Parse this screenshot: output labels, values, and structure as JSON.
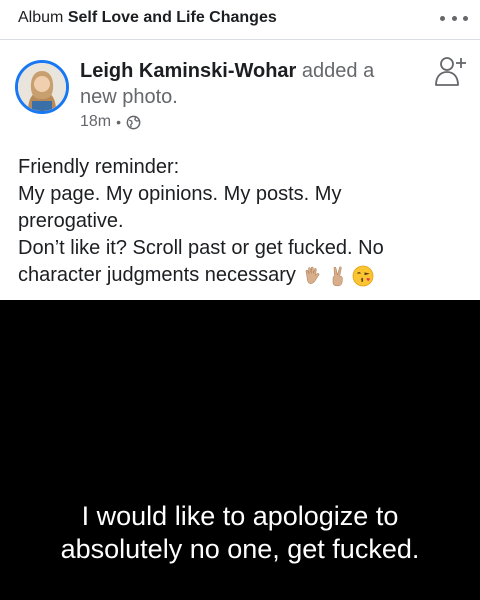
{
  "album": {
    "prefix": "Album",
    "name": "Self Love and Life Changes"
  },
  "post": {
    "author": "Leigh Kaminski-Wohar",
    "action": "added a new photo.",
    "time": "18m",
    "privacy_icon": "globe-icon",
    "text_lines": [
      "Friendly reminder:",
      "My page. My opinions. My posts. My",
      "prerogative.",
      "Don’t like it? Scroll past or get fucked. No",
      "character judgments necessary"
    ],
    "emojis": [
      "waving-hand-emoji",
      "victory-hand-emoji",
      "kissing-face-emoji"
    ]
  },
  "image": {
    "caption_lines": [
      "I would like to apologize to",
      "absolutely no one, get fucked."
    ]
  },
  "colors": {
    "accent": "#1877f2",
    "secondary_text": "#65676b",
    "divider": "#dadde1",
    "meme_background": "#000000"
  }
}
